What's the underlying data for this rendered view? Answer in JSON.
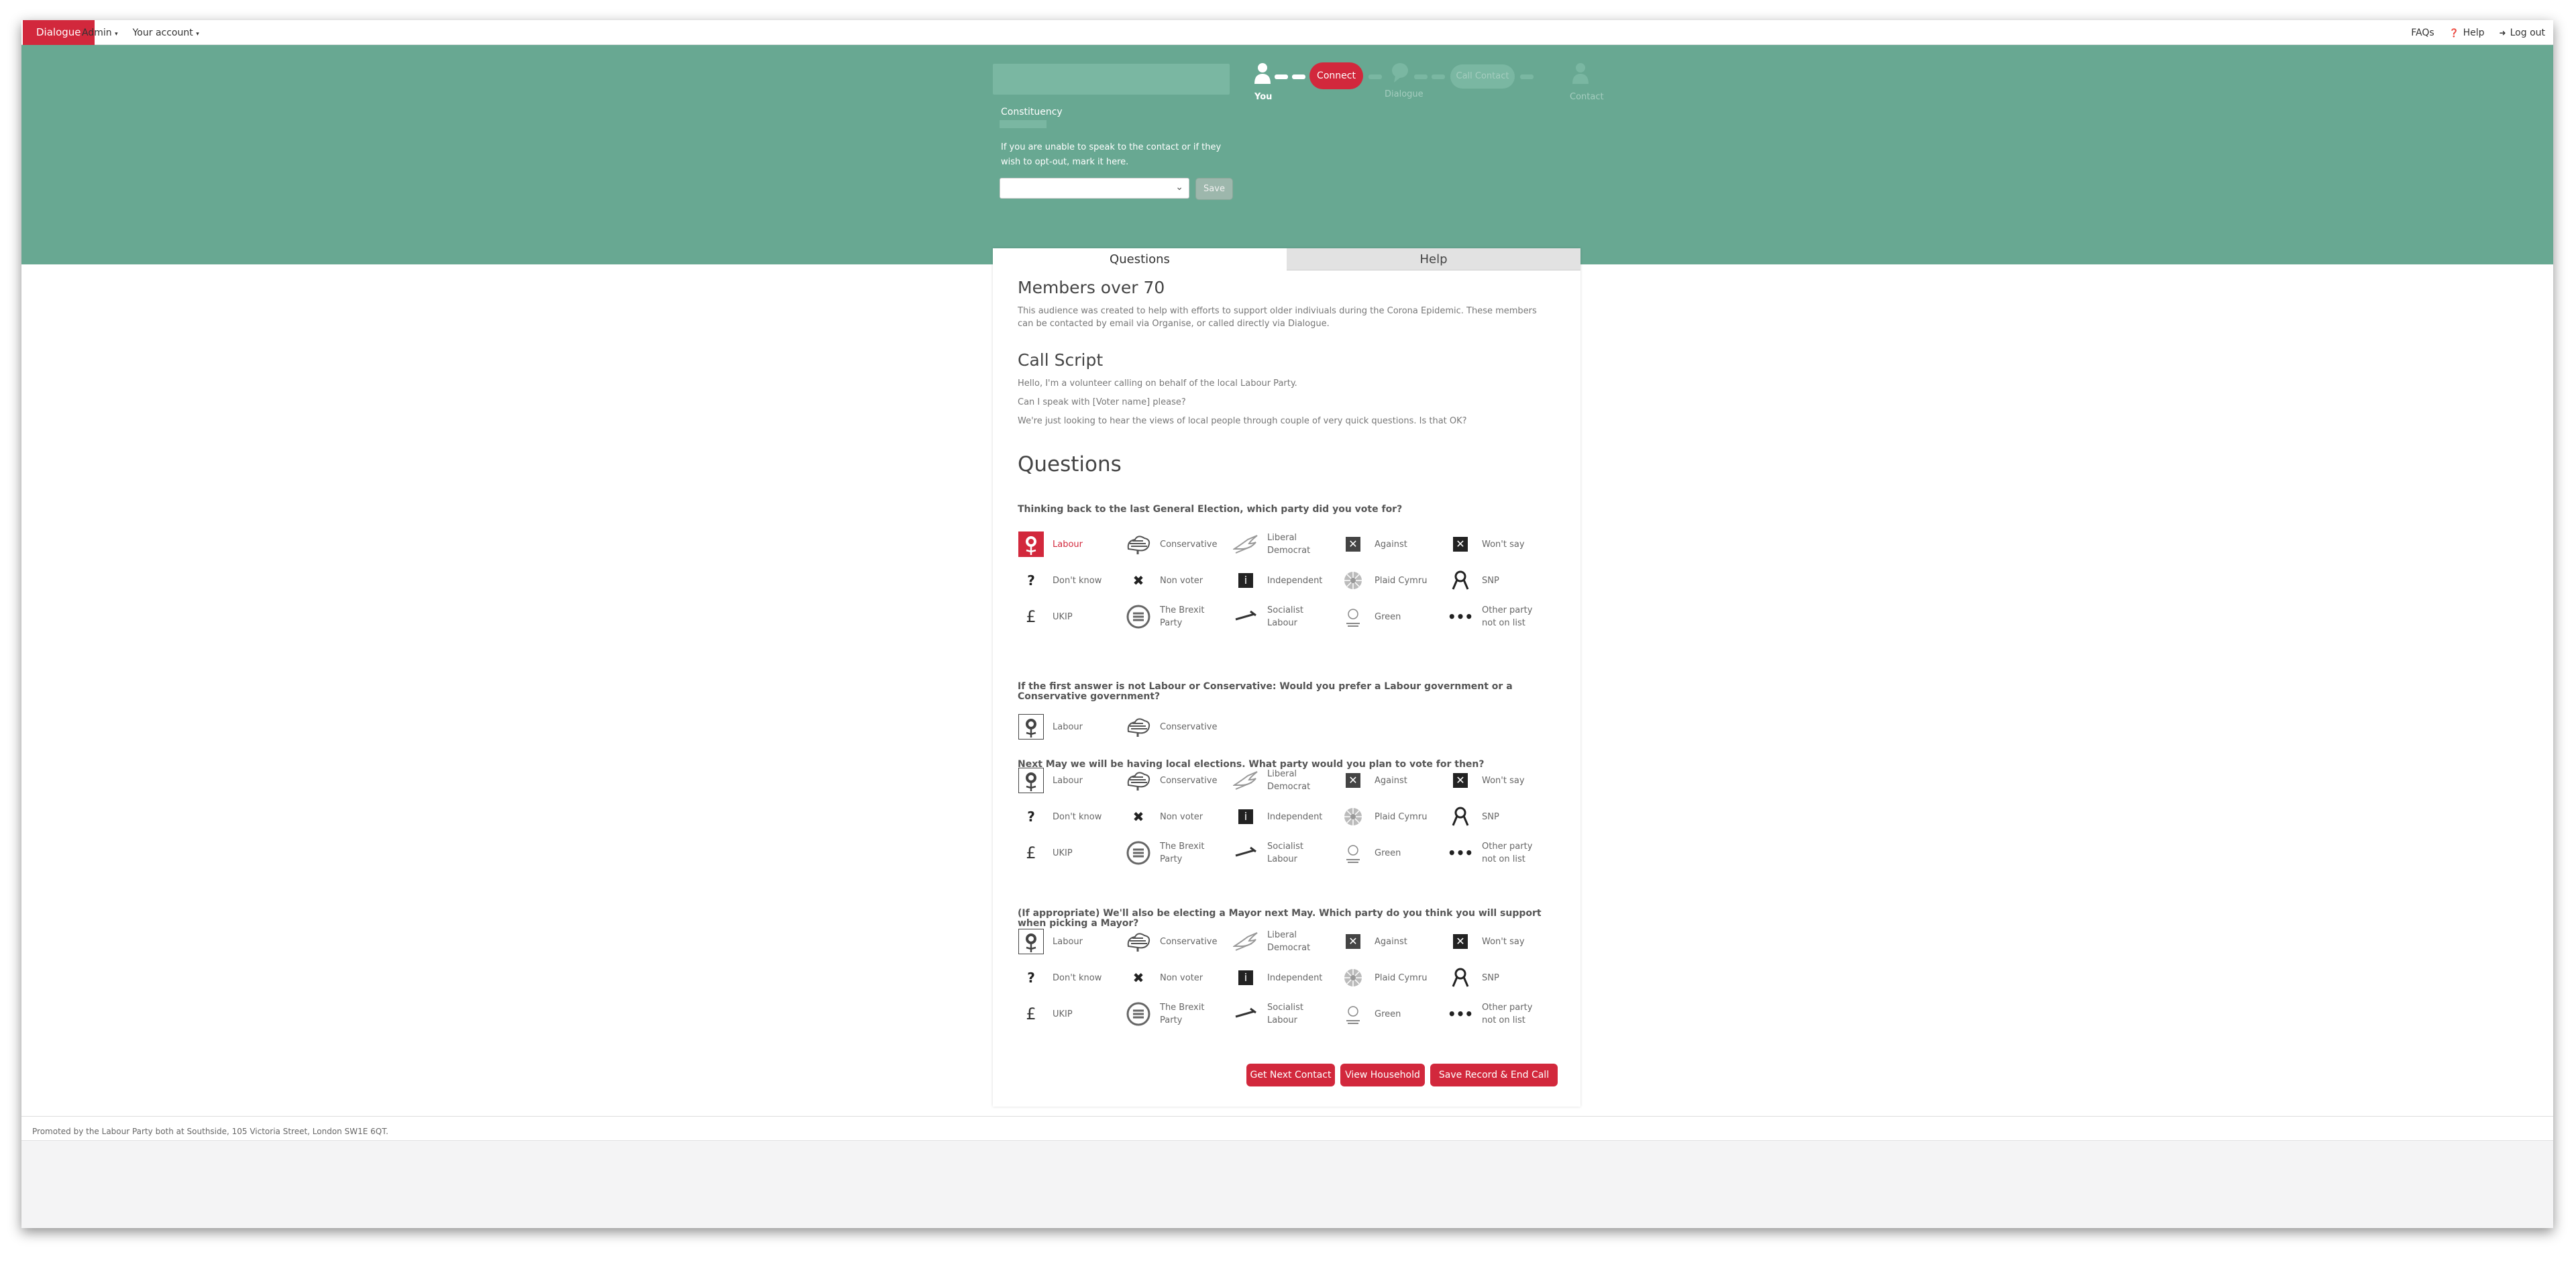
{
  "navbar": {
    "brand": "Dialogue",
    "admin": "Admin",
    "your_account": "Your account",
    "faqs": "FAQs",
    "help": "Help",
    "log_out": "Log out"
  },
  "banner": {
    "constituency_label": "Constituency",
    "optout_text": "If you are unable to speak to the contact or if they wish to opt-out, mark it here.",
    "select_value": "",
    "save_label": "Save",
    "progress": {
      "you_label": "You",
      "connect_label": "Connect",
      "dialogue_label": "Dialogue",
      "call_contact_label": "Call Contact",
      "contact_label": "Contact"
    }
  },
  "tabs": {
    "questions": "Questions",
    "help": "Help"
  },
  "intro": {
    "title": "Members over 70",
    "text": "This audience was created to help with efforts to support older indiviuals during the Corona Epidemic. These members can be contacted by email via Organise, or called directly via Dialogue."
  },
  "script": {
    "title": "Call Script",
    "line1": "Hello, I'm a volunteer calling on behalf of the local Labour Party.",
    "line2": "Can I speak with [Voter name] please?",
    "line3": "We're just looking to hear the views of local people through couple of very quick questions. Is that OK?"
  },
  "questions_title": "Questions",
  "options": {
    "labour": "Labour",
    "conservative": "Conservative",
    "libdem": "Liberal Democrat",
    "against": "Against",
    "wont_say": "Won't say",
    "dont_know": "Don't know",
    "non_voter": "Non voter",
    "independent": "Independent",
    "plaid": "Plaid Cymru",
    "snp": "SNP",
    "ukip": "UKIP",
    "brexit": "The Brexit Party",
    "socialist": "Socialist Labour",
    "green": "Green",
    "other": "Other party not on list"
  },
  "q1": {
    "title": "Thinking back to the last General Election, which party did you vote for?",
    "selected": "Labour"
  },
  "q2": {
    "title": "If the first answer is not Labour or Conservative: Would you prefer a Labour government or a Conservative government?"
  },
  "q3": {
    "title": "Next May we will be having local elections. What party would you plan to vote for then?"
  },
  "q4": {
    "title": "(If appropriate) We'll also be electing a Mayor next May. Which party do you think you will support when picking a Mayor?"
  },
  "buttons": {
    "next_contact": "Get Next Contact",
    "view_household": "View Household",
    "save_end": "Save Record & End Call"
  },
  "footer": {
    "promoted": "Promoted by the Labour Party both at Southside, 105 Victoria Street, London SW1E 6QT."
  },
  "colors": {
    "brand_red": "#d2283c",
    "banner_green": "#68a892"
  }
}
